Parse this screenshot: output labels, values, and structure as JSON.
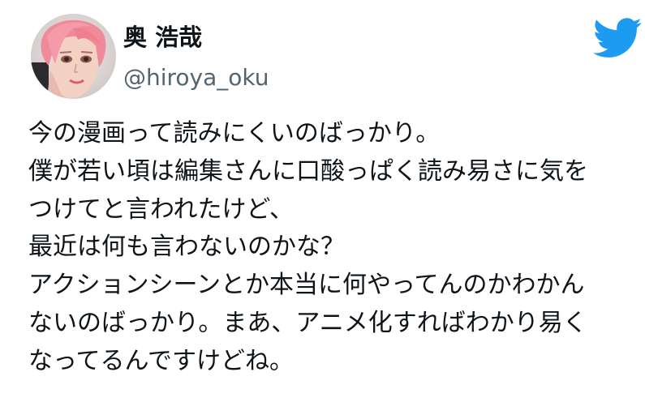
{
  "author": {
    "display_name": "奥 浩哉",
    "handle": "@hiroya_oku"
  },
  "icons": {
    "avatar": "profile-avatar",
    "brand": "twitter-bird-icon"
  },
  "colors": {
    "twitter_blue": "#1d9bf0",
    "handle_gray": "#536471",
    "text": "#0f1419"
  },
  "tweet": {
    "lines": [
      "今の漫画って読みにくいのばっかり。",
      "僕が若い頃は編集さんに口酸っぱく読み易さに気を",
      "つけてと言われたけど、",
      "最近は何も言わないのかな？",
      "アクションシーンとか本当に何やってんのかわかん",
      "ないのばっかり。まあ、アニメ化すればわかり易く",
      "なってるんですけどね。"
    ]
  }
}
